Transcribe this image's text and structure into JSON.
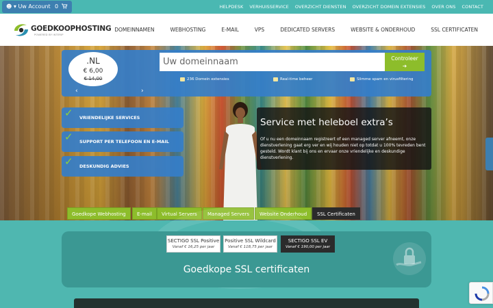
{
  "topbar": {
    "account_label": "Uw Account",
    "cart_count": "0",
    "links": [
      "HELPDESK",
      "VERHUISSERVICE",
      "OVERZICHT DIENSTEN",
      "OVERZICHT DOMEIN EXTENSIES",
      "OVER ONS",
      "CONTACT"
    ]
  },
  "header": {
    "logo_text": "GOEDKOOPHOSTING",
    "logo_sub": "POWERED BY INTERIP",
    "nav": [
      "DOMEINNAMEN",
      "WEBHOSTING",
      "E-MAIL",
      "VPS",
      "DEDICATED SERVERS",
      "WEBSITE & ONDERHOUD",
      "SSL CERTIFICATEN"
    ]
  },
  "domain": {
    "tld": ".NL",
    "price": "€ 6,00",
    "old_price": "€ 14,00",
    "prev_arrow": "‹",
    "next_arrow": "›",
    "placeholder": "Uw domeinnaam",
    "check_label": "Controleer",
    "check_arrow": "➔",
    "features": [
      "236 Domein extensies",
      "Real-time beheer",
      "Slimme spam en virusfiltering"
    ]
  },
  "badges": [
    "VRIENDELIJKE SERVICES",
    "SUPPORT PER TELEFOON EN E-MAIL",
    "DESKUNDIG ADVIES"
  ],
  "badge_check": "✓",
  "info": {
    "title": "Service met heleboel extra’s",
    "body": "Of u nu een domeinnaam registreert of een managed server afneemt, onze dienstverlening gaat erg ver en wij houden niet op totdat u 100% tevreden bent gesteld. Wordt klant bij ons en ervaar onze vriendelijke en deskundige dienstverlening."
  },
  "categories": [
    "Goedkope Webhosting",
    "E-mail",
    "Virtual Servers",
    "Managed Servers",
    "Website Onderhoud",
    "SSL Certificaten"
  ],
  "ssl": {
    "cards": [
      {
        "name": "SECTIGO SSL Positive",
        "price": "Vanaf € 16,25 per jaar"
      },
      {
        "name": "Positive SSL Wildcard",
        "price": "Vanaf € 118,75 per jaar"
      },
      {
        "name": "SECTIGO SSL EV",
        "price": "Vanaf € 190,00 per jaar"
      }
    ],
    "heading": "Goedkope SSL certificaten"
  },
  "colors": {
    "teal": "#4ab8b2",
    "blue_panel": "#357ec9",
    "green": "#8dbd2b",
    "dark": "#2b2b2b"
  },
  "icons": [
    "user-icon",
    "cart-icon",
    "cloud-icon",
    "server-icon",
    "envelope-icon",
    "check-icon",
    "lock-icon",
    "recaptcha-icon"
  ]
}
